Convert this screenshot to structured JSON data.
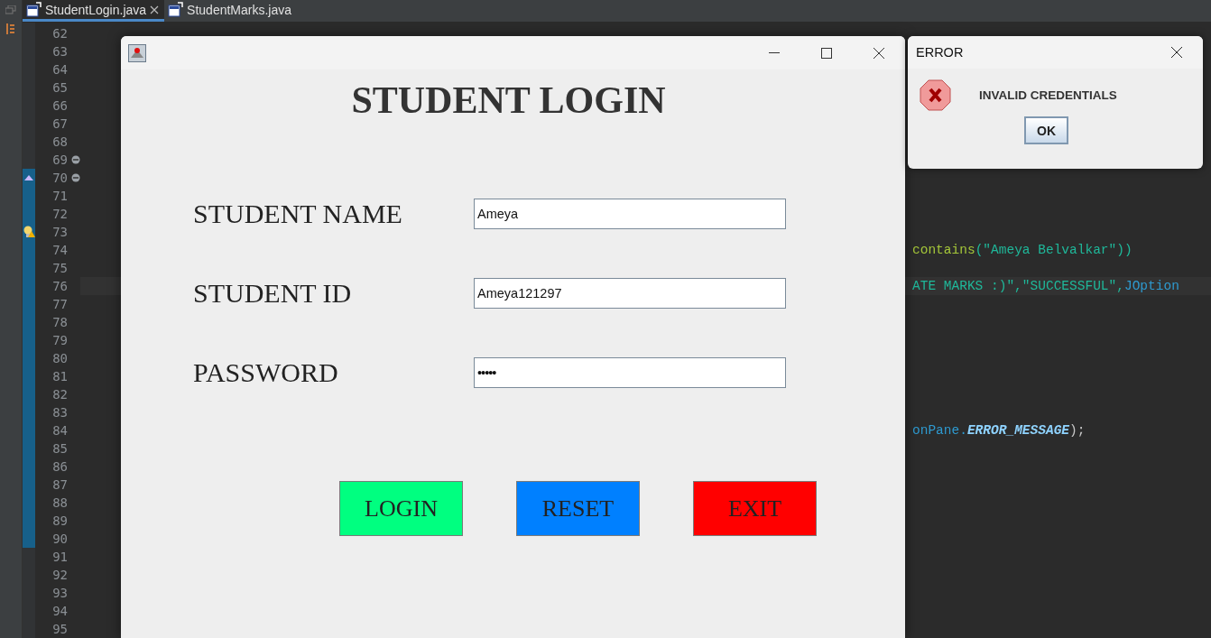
{
  "editor_tabs": [
    {
      "label": "StudentLogin.java",
      "selected": true,
      "closable": true
    },
    {
      "label": "StudentMarks.java",
      "selected": false,
      "closable": false
    }
  ],
  "editor": {
    "lines": [
      {
        "number": "62",
        "current": false,
        "fold": false
      },
      {
        "number": "63",
        "current": false,
        "fold": false
      },
      {
        "number": "64",
        "current": false,
        "fold": false
      },
      {
        "number": "65",
        "current": false,
        "fold": false
      },
      {
        "number": "66",
        "current": false,
        "fold": false
      },
      {
        "number": "67",
        "current": false,
        "fold": false
      },
      {
        "number": "68",
        "current": false,
        "fold": false
      },
      {
        "number": "69",
        "current": false,
        "fold": true
      },
      {
        "number": "70",
        "current": false,
        "fold": true
      },
      {
        "number": "71",
        "current": false,
        "fold": false
      },
      {
        "number": "72",
        "current": false,
        "fold": false
      },
      {
        "number": "73",
        "current": false,
        "fold": false
      },
      {
        "number": "74",
        "current": false,
        "fold": false,
        "tokens": [
          {
            "kind": "method",
            "text": "contains"
          },
          {
            "kind": "string",
            "text": "(\"Ameya Belvalkar\"))"
          }
        ]
      },
      {
        "number": "75",
        "current": false,
        "fold": false
      },
      {
        "number": "76",
        "current": true,
        "fold": false,
        "tokens": [
          {
            "kind": "string",
            "text": "ATE MARKS :)\",\"SUCCESSFUL\","
          },
          {
            "kind": "field",
            "text": "JOption"
          }
        ]
      },
      {
        "number": "77",
        "current": false,
        "fold": false
      },
      {
        "number": "78",
        "current": false,
        "fold": false
      },
      {
        "number": "79",
        "current": false,
        "fold": false
      },
      {
        "number": "80",
        "current": false,
        "fold": false
      },
      {
        "number": "81",
        "current": false,
        "fold": false
      },
      {
        "number": "82",
        "current": false,
        "fold": false
      },
      {
        "number": "83",
        "current": false,
        "fold": false
      },
      {
        "number": "84",
        "current": false,
        "fold": false,
        "tokens": [
          {
            "kind": "field",
            "text": "onPane."
          },
          {
            "kind": "constant",
            "text": "ERROR_MESSAGE"
          },
          {
            "kind": "plain",
            "text": ");"
          }
        ]
      },
      {
        "number": "85",
        "current": false,
        "fold": false
      },
      {
        "number": "86",
        "current": false,
        "fold": false
      },
      {
        "number": "87",
        "current": false,
        "fold": false
      },
      {
        "number": "88",
        "current": false,
        "fold": false
      },
      {
        "number": "89",
        "current": false,
        "fold": false
      },
      {
        "number": "90",
        "current": false,
        "fold": false
      },
      {
        "number": "91",
        "current": false,
        "fold": false
      },
      {
        "number": "92",
        "current": false,
        "fold": false
      },
      {
        "number": "93",
        "current": false,
        "fold": false
      },
      {
        "number": "94",
        "current": false,
        "fold": false
      },
      {
        "number": "95",
        "current": false,
        "fold": false
      }
    ]
  },
  "login_window": {
    "heading": "STUDENT LOGIN",
    "fields": [
      {
        "label": "STUDENT NAME",
        "value": "Ameya",
        "kind": "text"
      },
      {
        "label": "STUDENT ID",
        "value": "Ameya121297",
        "kind": "text"
      },
      {
        "label": "PASSWORD",
        "value": "•••••",
        "kind": "password"
      }
    ],
    "buttons": [
      {
        "label": "LOGIN",
        "color": "#00ff80"
      },
      {
        "label": "RESET",
        "color": "#0080ff"
      },
      {
        "label": "EXIT",
        "color": "#ff0000"
      }
    ]
  },
  "error_dialog": {
    "title": "ERROR",
    "message": "INVALID CREDENTIALS",
    "button": "OK"
  }
}
